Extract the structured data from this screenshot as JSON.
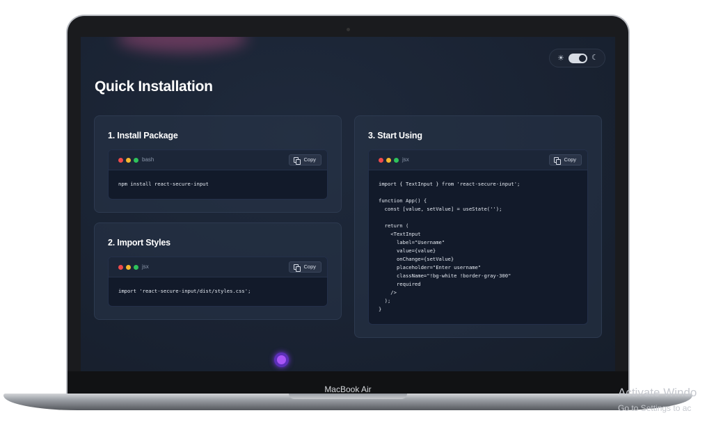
{
  "device": {
    "model_label": "MacBook Air"
  },
  "header": {
    "title": "Quick Installation"
  },
  "theme_toggle": {
    "sun_icon": "sun-icon",
    "moon_icon": "moon-icon",
    "state": "dark"
  },
  "steps": [
    {
      "title": "1. Install Package",
      "language": "bash",
      "copy_label": "Copy",
      "code": "npm install react-secure-input"
    },
    {
      "title": "2. Import Styles",
      "language": "jsx",
      "copy_label": "Copy",
      "code": "import 'react-secure-input/dist/styles.css';"
    },
    {
      "title": "3. Start Using",
      "language": "jsx",
      "copy_label": "Copy",
      "code": "import { TextInput } from 'react-secure-input';\n\nfunction App() {\n  const [value, setValue] = useState('');\n\n  return (\n    <TextInput\n      label=\"Username\"\n      value={value}\n      onChange={setValue}\n      placeholder=\"Enter username\"\n      className=\"!bg-white !border-gray-300\"\n      required\n    />\n  );\n}"
    }
  ],
  "colors": {
    "accent": "#a855f7",
    "dot_red": "#ef4b4b",
    "dot_yellow": "#f5b82e",
    "dot_green": "#2ec25b"
  },
  "os_overlay": {
    "title": "Activate Windo",
    "subtitle": "Go to Settings to ac"
  }
}
